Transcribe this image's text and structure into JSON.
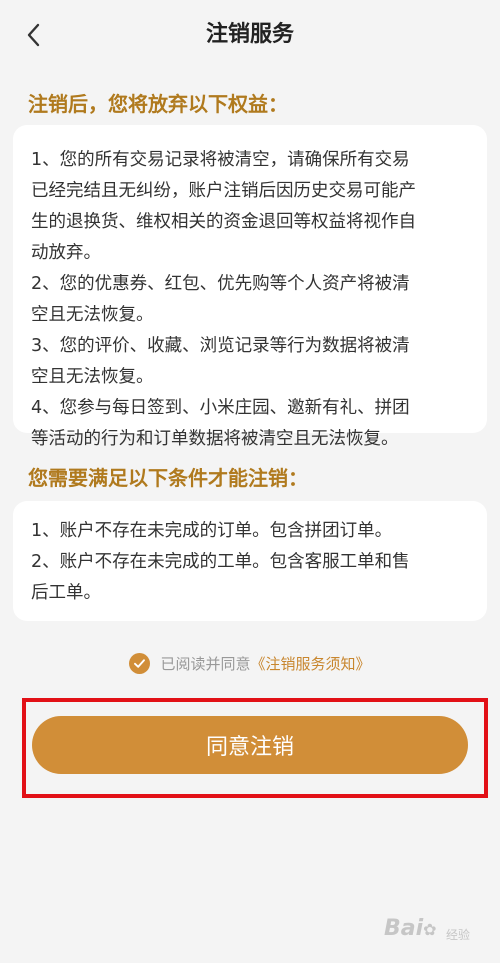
{
  "header": {
    "title": "注销服务"
  },
  "section1": {
    "title": "注销后，您将放弃以下权益：",
    "lines": [
      "1、您的所有交易记录将被清空，请确保所有交易",
      "已经完结且无纠纷，账户注销后因历史交易可能产",
      "生的退换货、维权相关的资金退回等权益将视作自",
      "动放弃。",
      "2、您的优惠券、红包、优先购等个人资产将被清",
      "空且无法恢复。",
      "3、您的评价、收藏、浏览记录等行为数据将被清",
      "空且无法恢复。",
      "4、您参与每日签到、小米庄园、邀新有礼、拼团",
      "等活动的行为和订单数据将被清空且无法恢复。"
    ]
  },
  "section2": {
    "title": "您需要满足以下条件才能注销：",
    "lines": [
      "1、账户不存在未完成的订单。包含拼团订单。",
      "2、账户不存在未完成的工单。包含客服工单和售",
      "后工单。"
    ]
  },
  "agreement": {
    "checked": true,
    "text": "已阅读并同意",
    "link": "《注销服务须知》"
  },
  "confirm_button": {
    "label": "同意注销"
  },
  "watermark": {
    "brand": "Baidu",
    "sub": "经验"
  },
  "colors": {
    "accent": "#d18e38",
    "section_title": "#b07a1e",
    "highlight_border": "#e21016",
    "background": "#f4f4f4"
  }
}
